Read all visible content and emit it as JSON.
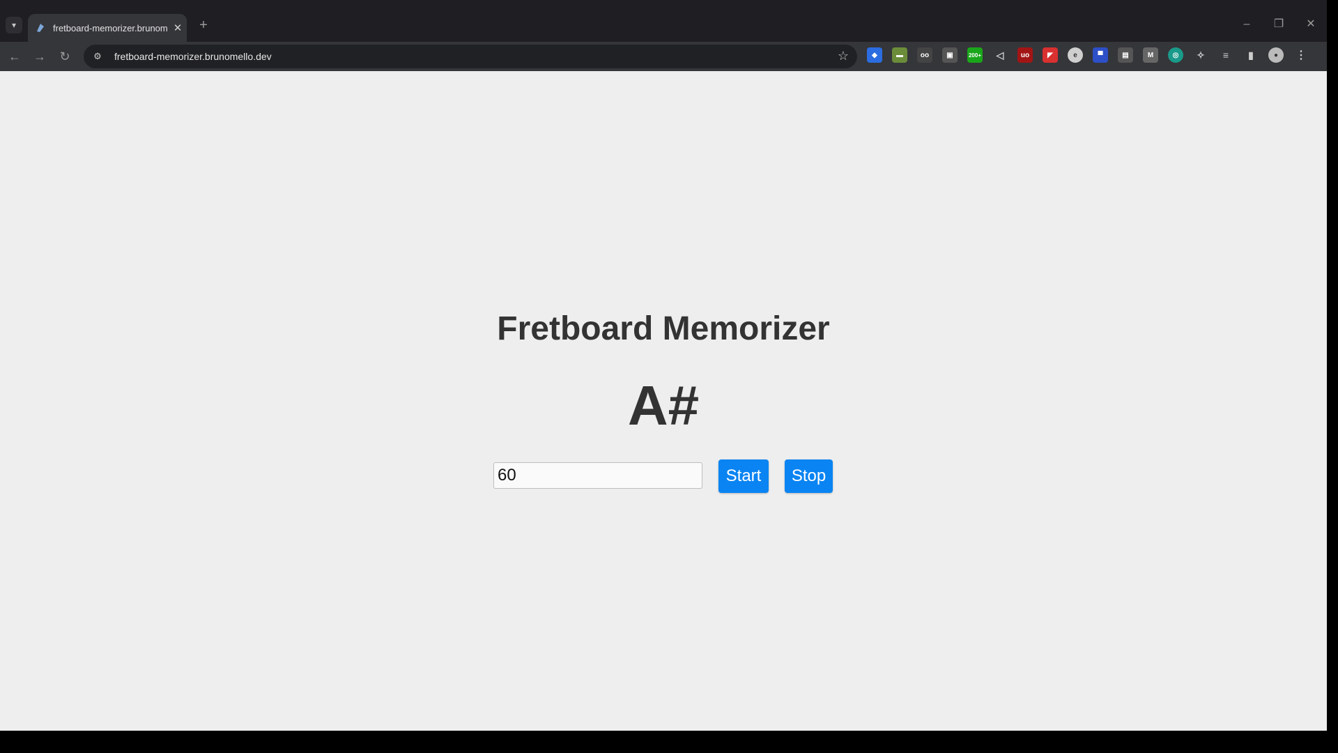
{
  "browser": {
    "tab_title": "fretboard-memorizer.brunomello.dev",
    "tab_close": "✕",
    "new_tab": "+",
    "url": "fretboard-memorizer.brunomello.dev",
    "icons": [
      "shield-icon",
      "folder-icon",
      "glasses-icon",
      "screenshot-icon",
      "counter-icon",
      "mute-icon",
      "ublock-icon",
      "flag-icon",
      "circle-icon",
      "square-icon",
      "grid-icon",
      "box-icon",
      "sync-icon",
      "puzzle-icon",
      "media-icon",
      "sidepanel-icon",
      "profile-icon",
      "menu-icon"
    ],
    "badge_text": "200+"
  },
  "page": {
    "title": "Fretboard Memorizer",
    "note": "A#",
    "input_value": "60",
    "start_label": "Start",
    "stop_label": "Stop"
  },
  "colors": {
    "accent": "#0a84f2",
    "background": "#eeeeee",
    "text": "#333333"
  }
}
